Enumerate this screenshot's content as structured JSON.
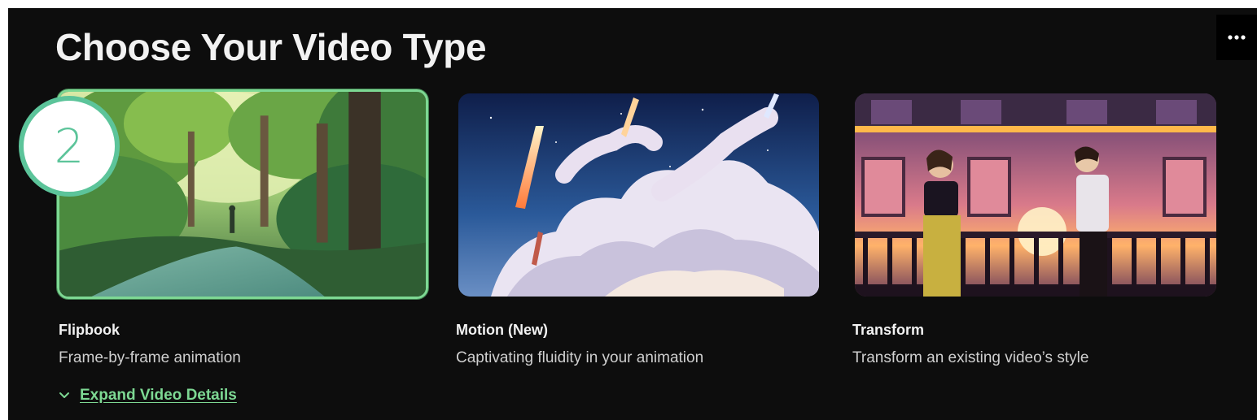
{
  "page": {
    "title": "Choose Your Video Type",
    "more_icon": "more-horizontal-icon"
  },
  "step_badge": {
    "number": "2"
  },
  "video_types": [
    {
      "name": "Flipbook",
      "description": "Frame-by-frame animation",
      "selected": true
    },
    {
      "name": "Motion (New)",
      "description": "Captivating fluidity in your animation",
      "selected": false
    },
    {
      "name": "Transform",
      "description": "Transform an existing video’s style",
      "selected": false
    }
  ],
  "expand": {
    "label": "Expand Video Details",
    "icon": "chevron-down-icon"
  },
  "colors": {
    "background": "#0d0d0d",
    "accent_green": "#7dd893",
    "badge_teal": "#5cc49a",
    "text_primary": "#f2f2f2",
    "text_secondary": "#cfcfcf"
  }
}
